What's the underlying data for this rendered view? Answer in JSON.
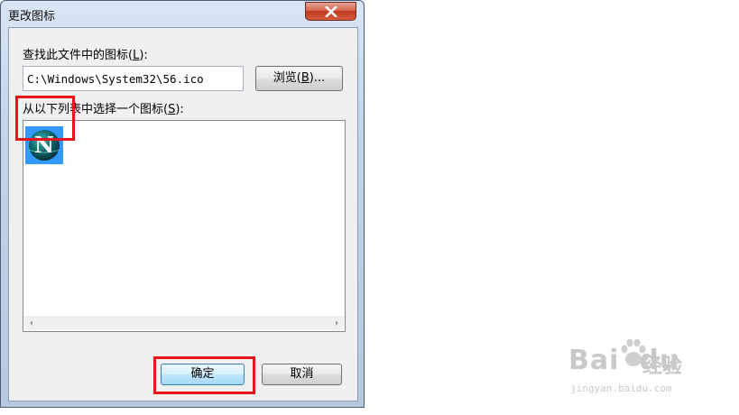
{
  "dialog": {
    "title": "更改图标",
    "find_label_pre": "查找此文件中的图标(",
    "find_label_key": "L",
    "find_label_post": "):",
    "path_value": "C:\\Windows\\System32\\56.ico",
    "browse_pre": "浏览(",
    "browse_key": "B",
    "browse_post": ")...",
    "list_label_pre": "从以下列表中选择一个图标(",
    "list_label_key": "S",
    "list_label_post": "):",
    "icon_letter": "N",
    "ok_label": "确定",
    "cancel_label": "取消"
  },
  "watermark": {
    "brand_a": "Bai",
    "brand_b": "du",
    "brand_cn": "经验",
    "url": "jingyan.baidu.com"
  },
  "colors": {
    "highlight": "#e8141c",
    "selection": "#3399ff"
  }
}
